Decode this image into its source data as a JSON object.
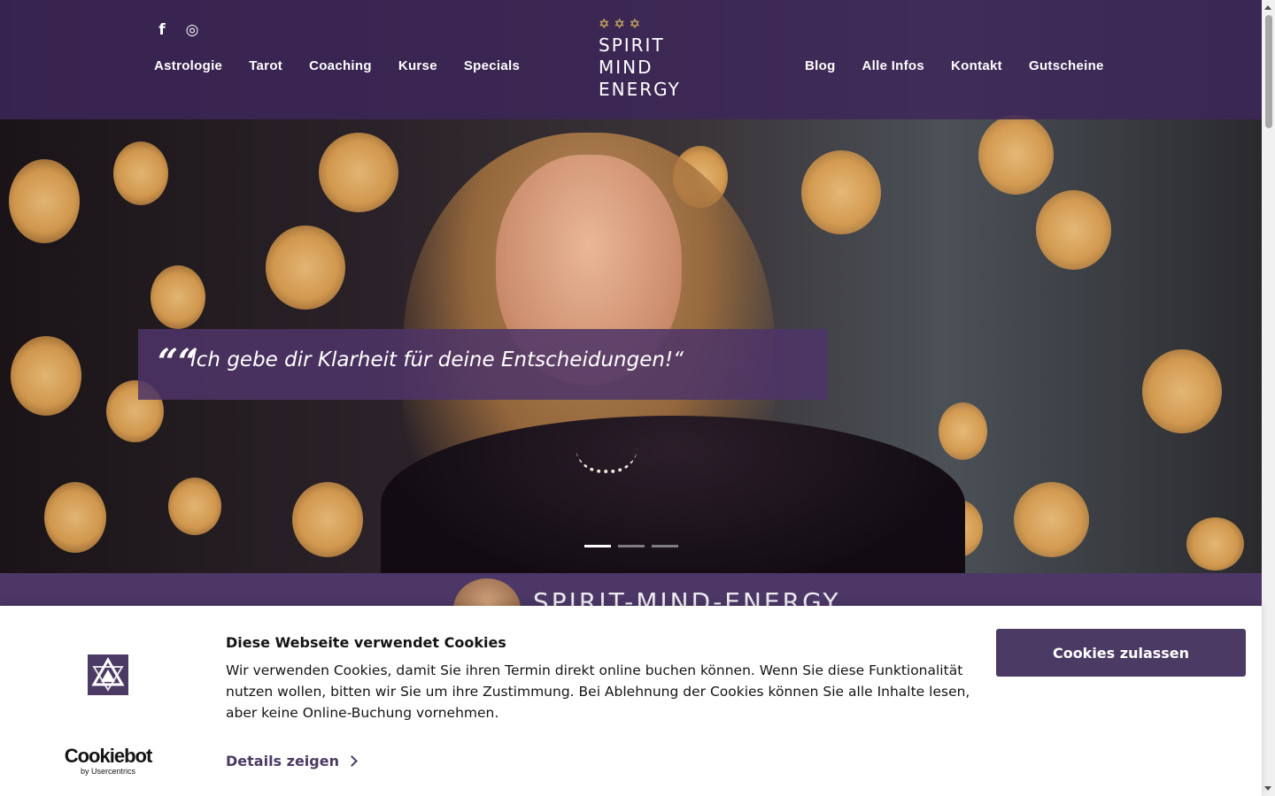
{
  "header": {
    "social": [
      {
        "icon": "facebook-icon",
        "glyph": "f"
      },
      {
        "icon": "instagram-icon",
        "glyph": "◎"
      }
    ],
    "nav_left": [
      "Astrologie",
      "Tarot",
      "Coaching",
      "Kurse",
      "Specials"
    ],
    "nav_right": [
      "Blog",
      "Alle Infos",
      "Kontakt",
      "Gutscheine"
    ],
    "logo": {
      "stars": "✡ ✡ ✡",
      "line1": "SPIRIT",
      "line2": "MIND",
      "line3": "ENERGY"
    }
  },
  "hero": {
    "quote_mark": "““",
    "quote": "Ich gebe dir Klarheit für deine Entscheidungen!“",
    "slides": 3,
    "active_slide": 1
  },
  "band": {
    "title": "SPIRIT-MIND-ENERGY"
  },
  "cookie": {
    "title": "Diese Webseite verwendet Cookies",
    "text": "Wir verwenden Cookies, damit Sie ihren Termin direkt online buchen können. Wenn Sie diese Funktionalität nutzen wollen, bitten wir Sie um ihre Zustimmung.   Bei Ablehnung der Cookies können Sie alle Inhalte lesen, aber keine Online-Buchung vornehmen.",
    "details": "Details zeigen",
    "allow": "Cookies zulassen",
    "brand": "Cookiebot",
    "brand_by": "by Usercentrics"
  },
  "colors": {
    "brand_purple": "#4b3a63",
    "header_purple": "#3e265a",
    "gold": "#e7c25b"
  }
}
